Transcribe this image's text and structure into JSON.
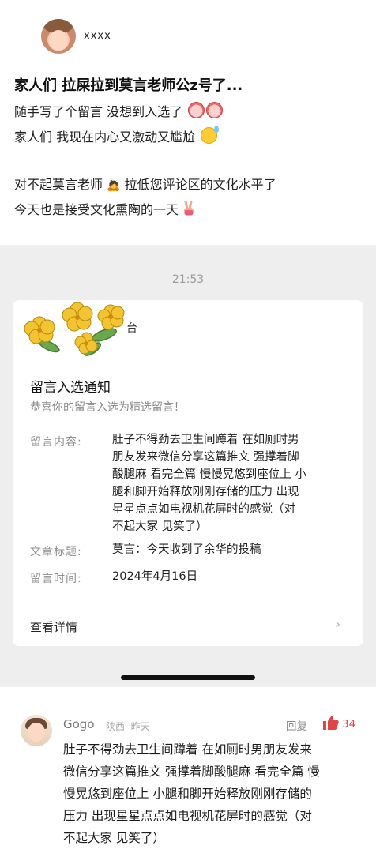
{
  "post": {
    "username": "xxxx",
    "title": "家人们 拉屎拉到莫言老师公z号了...",
    "lines": [
      "随手写了个留言 没想到入选了",
      "家人们 我现在内心又激动又尴尬",
      "对不起莫言老师",
      "拉低您评论区的文化水平了",
      "今天也是接受文化熏陶的一天"
    ],
    "icons": [
      "crying-face-icon",
      "sweat-smile-icon",
      "bowing-person-icon",
      "victory-hand-icon"
    ]
  },
  "notice": {
    "time": "21:53",
    "brand_suffix": "台",
    "title": "留言入选通知",
    "subtitle": "恭喜你的留言入选为精选留言！",
    "fields": [
      {
        "label": "留言内容:",
        "value_lines": [
          "肚子不得劲去卫生间蹲着 在如厕时男",
          "朋友发来微信分享这篇推文 强撑着脚",
          "酸腿麻 看完全篇 慢慢晃悠到座位上 小",
          "腿和脚开始释放刚刚存储的压力 出现",
          "星星点点如电视机花屏时的感觉（对",
          "不起大家 见笑了）"
        ]
      },
      {
        "label": "文章标题:",
        "value_lines": [
          "莫言：今天收到了余华的投稿"
        ]
      },
      {
        "label": "留言时间:",
        "value_lines": [
          "2024年4月16日"
        ]
      }
    ],
    "detail_link": "查看详情"
  },
  "comment": {
    "name": "Gogo",
    "location": "陕西",
    "time": "昨天",
    "reply_label": "回复",
    "likes": "34",
    "like_color": "#e04545",
    "lines": [
      "肚子不得劲去卫生间蹲着 在如厕时男朋友发来",
      "微信分享这篇推文 强撑着脚酸腿麻 看完全篇 慢",
      "慢晃悠到座位上 小腿和脚开始释放刚刚存储的",
      "压力 出现星星点点如电视机花屏时的感觉（对",
      "不起大家 见笑了）"
    ]
  }
}
